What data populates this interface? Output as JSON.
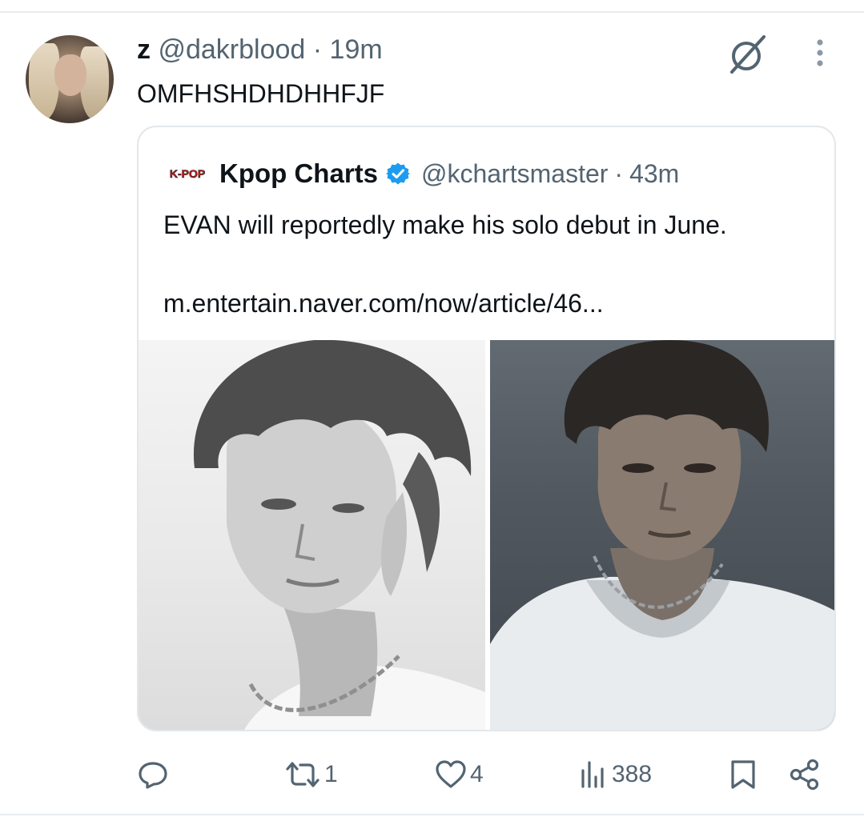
{
  "tweet": {
    "display_name": "z",
    "handle": "@dakrblood",
    "separator": "·",
    "time": "19m",
    "text": "OMFHSHDHDHHFJF"
  },
  "quoted_tweet": {
    "logo_text": "K-POP",
    "display_name": "Kpop Charts",
    "verified": true,
    "handle": "@kchartsmaster",
    "separator": "·",
    "time": "43m",
    "text": "EVAN will reportedly make his solo debut in June.",
    "link": "m.entertain.naver.com/now/article/46..."
  },
  "actions": {
    "reply": {
      "icon": "reply-icon",
      "count": ""
    },
    "retweet": {
      "icon": "retweet-icon",
      "count": "1"
    },
    "like": {
      "icon": "heart-icon",
      "count": "4"
    },
    "views": {
      "icon": "views-icon",
      "count": "388"
    },
    "bookmark": {
      "icon": "bookmark-icon"
    },
    "share": {
      "icon": "share-icon"
    }
  },
  "colors": {
    "text_primary": "#0f1419",
    "text_secondary": "#536471",
    "verified_blue": "#1d9bf0",
    "kpop_red": "#d81e1e",
    "border": "#e1e8ed"
  }
}
